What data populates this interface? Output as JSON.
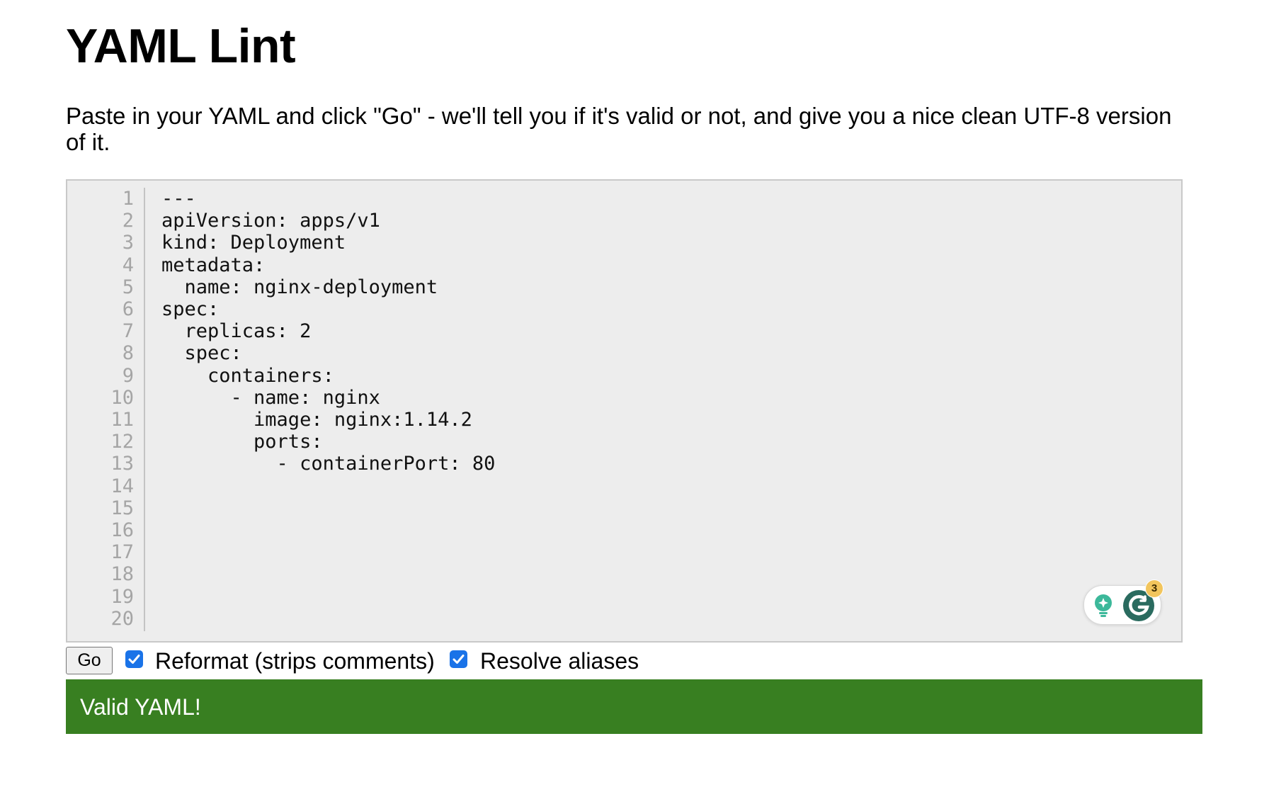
{
  "header": {
    "title": "YAML Lint"
  },
  "intro": {
    "text": "Paste in your YAML and click \"Go\" - we'll tell you if it's valid or not, and give you a nice clean UTF-8 version of it."
  },
  "editor": {
    "line_numbers": [
      "1",
      "2",
      "3",
      "4",
      "5",
      "6",
      "7",
      "8",
      "9",
      "10",
      "11",
      "12",
      "13",
      "14",
      "15",
      "16",
      "17",
      "18",
      "19",
      "20"
    ],
    "lines": [
      "---",
      "apiVersion: apps/v1",
      "kind: Deployment",
      "metadata:",
      "  name: nginx-deployment",
      "spec:",
      "  replicas: 2",
      "  spec:",
      "    containers:",
      "      - name: nginx",
      "        image: nginx:1.14.2",
      "        ports:",
      "          - containerPort: 80"
    ]
  },
  "grammarly": {
    "badge_count": "3",
    "colors": {
      "bulb": "#3cb89a",
      "logo": "#2a6b5f",
      "badge": "#f2c55c"
    }
  },
  "controls": {
    "go_label": "Go",
    "reformat_label": "Reformat (strips comments)",
    "reformat_checked": true,
    "resolve_label": "Resolve aliases",
    "resolve_checked": true
  },
  "result": {
    "message": "Valid YAML!",
    "color": "#387f21"
  }
}
